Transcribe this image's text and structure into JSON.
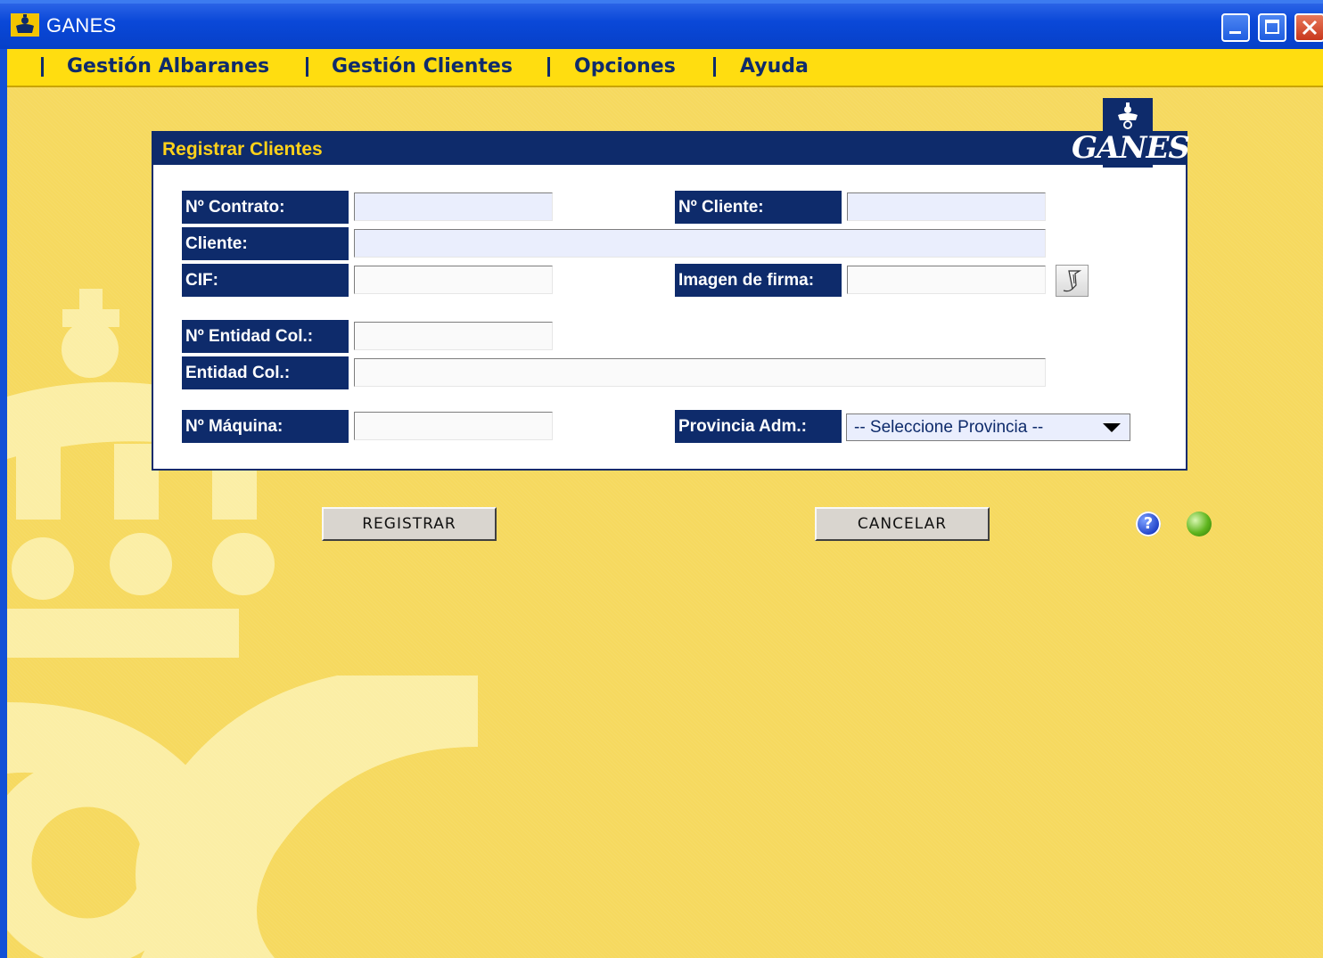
{
  "window": {
    "title": "GANES"
  },
  "menu": {
    "items": [
      {
        "label": "Gestión Albaranes"
      },
      {
        "label": "Gestión Clientes"
      },
      {
        "label": "Opciones"
      },
      {
        "label": "Ayuda"
      }
    ]
  },
  "panel": {
    "title": "Registrar Clientes",
    "logo_text": "GANES"
  },
  "form": {
    "contrato_label": "Nº Contrato:",
    "contrato_value": "",
    "cliente_num_label": "Nº Cliente:",
    "cliente_num_value": "",
    "cliente_label": "Cliente:",
    "cliente_value": "",
    "cif_label": "CIF:",
    "cif_value": "",
    "firma_label": "Imagen de firma:",
    "firma_value": "",
    "entidad_num_label": "Nº Entidad Col.:",
    "entidad_num_value": "",
    "entidad_label": "Entidad Col.:",
    "entidad_value": "",
    "maquina_label": "Nº Máquina:",
    "maquina_value": "",
    "provincia_label": "Provincia Adm.:",
    "provincia_selected": "-- Seleccione Provincia --"
  },
  "buttons": {
    "registrar": "REGISTRAR",
    "cancelar": "CANCELAR",
    "help": "?"
  },
  "icons": {
    "app": "postal-crown-icon",
    "signature": "signature-pen-icon",
    "help": "help-icon",
    "status": "status-green-icon"
  },
  "colors": {
    "navy": "#0e2b6b",
    "yellow": "#ffdd10",
    "background": "#f6d95f",
    "title_text": "#ffd21a"
  }
}
